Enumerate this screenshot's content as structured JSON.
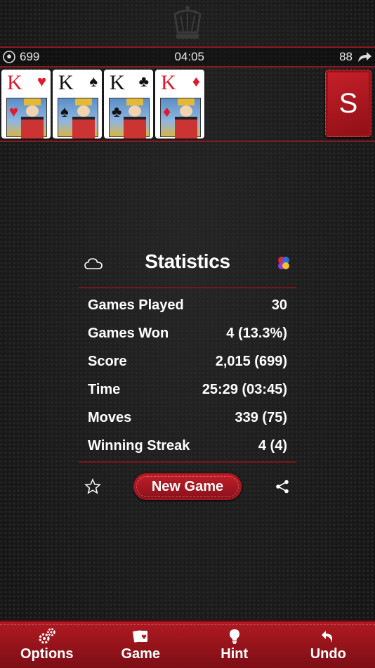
{
  "topbar": {
    "score": "699",
    "timer": "04:05",
    "moves": "88"
  },
  "foundation": [
    {
      "rank": "K",
      "suit": "♥",
      "color": "red"
    },
    {
      "rank": "K",
      "suit": "♠",
      "color": "black"
    },
    {
      "rank": "K",
      "suit": "♣",
      "color": "black"
    },
    {
      "rank": "K",
      "suit": "♦",
      "color": "red"
    }
  ],
  "stock": {
    "letter": "S"
  },
  "statistics": {
    "title": "Statistics",
    "rows": [
      {
        "label": "Games Played",
        "value": "30"
      },
      {
        "label": "Games Won",
        "value": "4 (13.3%)"
      },
      {
        "label": "Score",
        "value": "2,015 (699)"
      },
      {
        "label": "Time",
        "value": "25:29 (03:45)"
      },
      {
        "label": "Moves",
        "value": "339 (75)"
      },
      {
        "label": "Winning Streak",
        "value": "4 (4)"
      }
    ],
    "new_game_label": "New Game"
  },
  "bottombar": {
    "options": "Options",
    "game": "Game",
    "hint": "Hint",
    "undo": "Undo"
  },
  "colors": {
    "accent": "#b01a22",
    "rule": "#8a1a1f"
  }
}
